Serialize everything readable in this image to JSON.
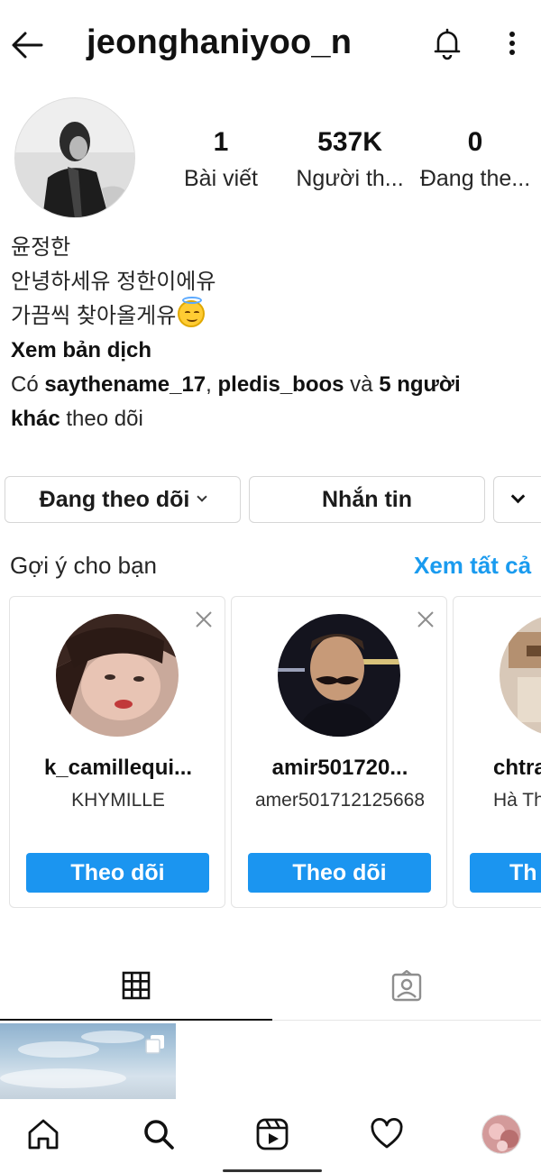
{
  "header": {
    "username": "jeonghaniyoo_n",
    "back_icon": "arrow-left-icon",
    "bell_icon": "bell-icon",
    "more_icon": "more-vertical-icon"
  },
  "stats": {
    "posts": {
      "value": "1",
      "label": "Bài viết"
    },
    "followers": {
      "value": "537K",
      "label": "Người th..."
    },
    "following": {
      "value": "0",
      "label": "Đang the..."
    }
  },
  "bio": {
    "name": "윤정한",
    "line1": "안녕하세유 정한이에유",
    "line2": "가끔씩 찾아올게유",
    "emoji": "😇",
    "translate": "Xem bản dịch",
    "followed_prefix": "Có ",
    "followed_user1": "saythename_17",
    "followed_sep": ", ",
    "followed_user2": "pledis_boos",
    "followed_and": " và ",
    "followed_others_a": "5 người",
    "followed_others_b": "khác",
    "followed_suffix": " theo dõi"
  },
  "actions": {
    "following": "Đang theo dõi",
    "message": "Nhắn tin"
  },
  "suggestions": {
    "title": "Gợi ý cho bạn",
    "see_all": "Xem tất cả",
    "items": [
      {
        "username": "k_camillequi...",
        "subtitle": "KHYMILLE",
        "button": "Theo dõi"
      },
      {
        "username": "amir501720...",
        "subtitle": "amer501712125668",
        "button": "Theo dõi"
      },
      {
        "username": "chtra",
        "subtitle": "Hà Th",
        "button": "Th"
      }
    ]
  },
  "tabs": [
    "grid-icon",
    "tagged-icon"
  ],
  "nav": [
    "home-icon",
    "search-icon",
    "reels-icon",
    "heart-icon",
    "profile-avatar"
  ],
  "colors": {
    "accent": "#1b95f0",
    "link": "#1a9bef",
    "text": "#111111"
  }
}
